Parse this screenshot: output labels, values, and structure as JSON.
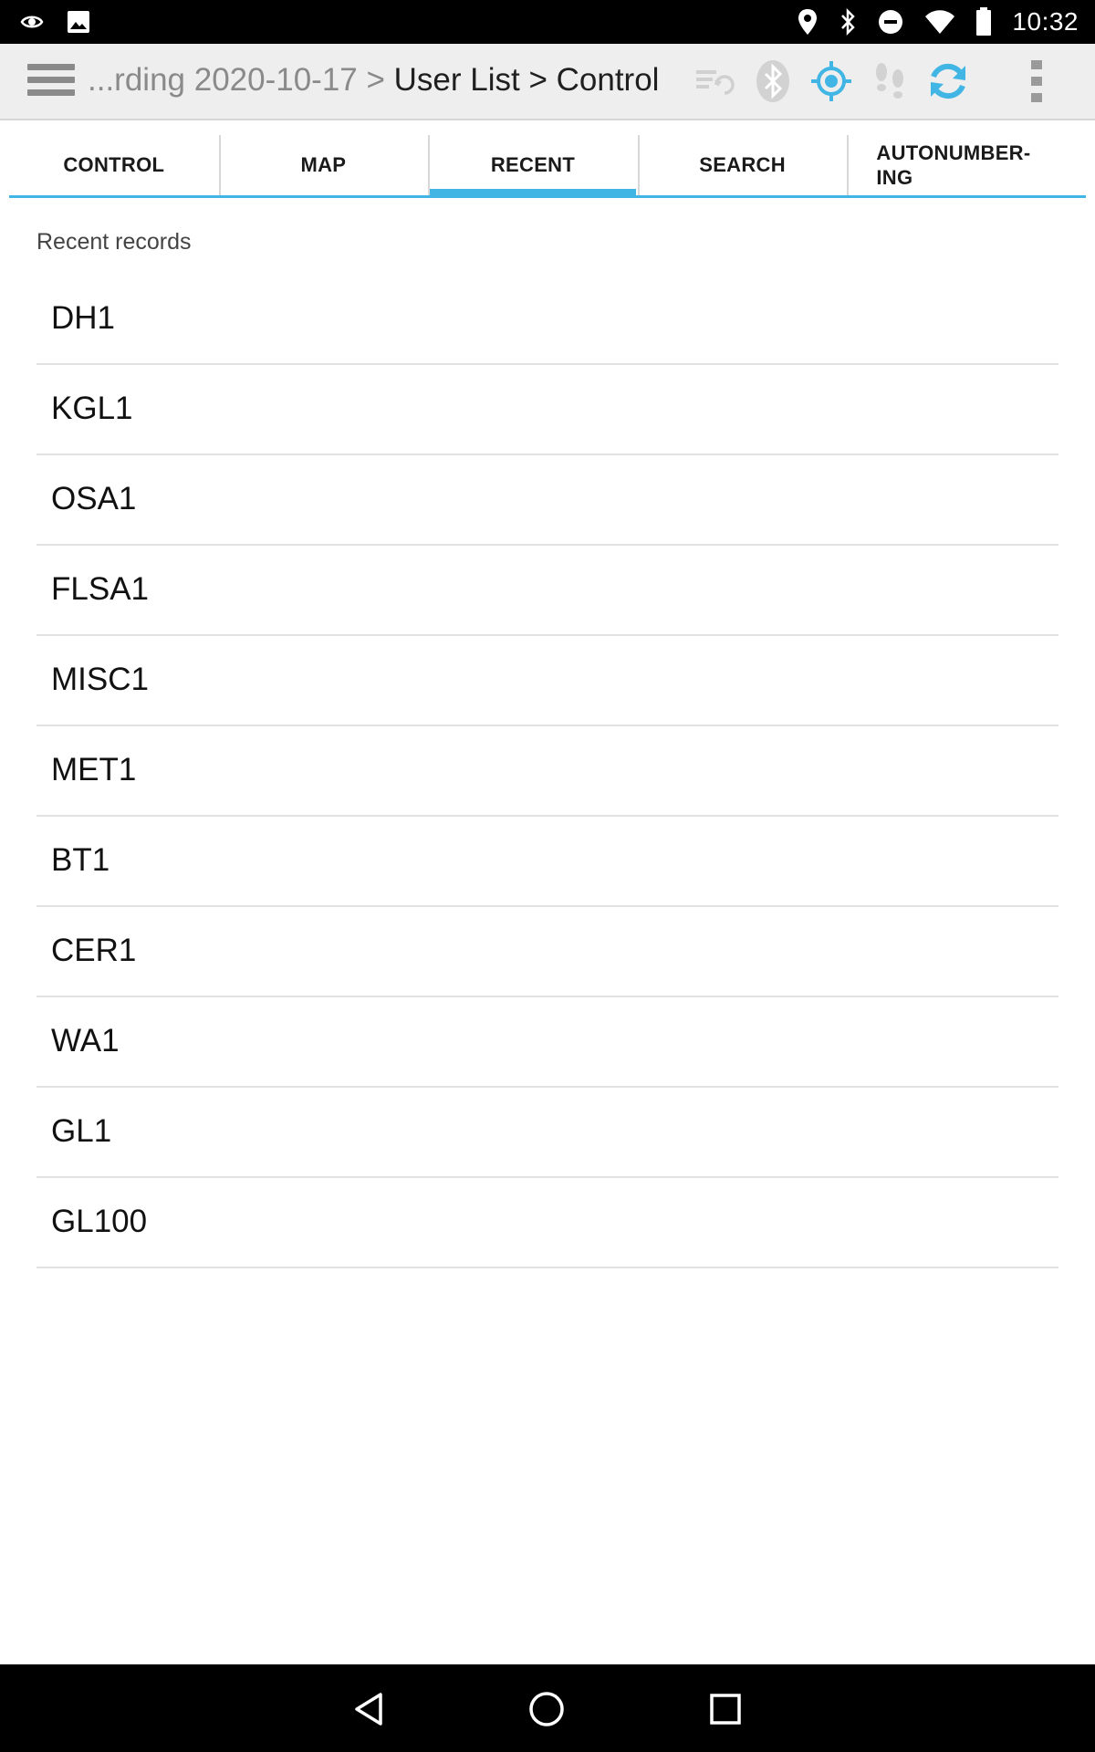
{
  "status_bar": {
    "time": "10:32",
    "icons": [
      "eye-icon",
      "image-icon",
      "location-pin-icon",
      "bluetooth-icon",
      "do-not-disturb-icon",
      "wifi-icon",
      "battery-icon"
    ]
  },
  "app_bar": {
    "breadcrumb_muted": "...rding 2020-10-17 > ",
    "breadcrumb_main": "User List > Control",
    "icons": [
      "menu-icon",
      "sync-list-icon",
      "bluetooth-icon",
      "gps-target-icon",
      "footsteps-icon",
      "refresh-icon",
      "overflow-menu-icon"
    ],
    "colors": {
      "accent": "#41b5e3",
      "muted": "#c8c8c8"
    }
  },
  "tabs": [
    {
      "label": "CONTROL",
      "active": false
    },
    {
      "label": "MAP",
      "active": false
    },
    {
      "label": "RECENT",
      "active": true
    },
    {
      "label": "SEARCH",
      "active": false
    },
    {
      "label": "AUTONUMBER-\nING",
      "active": false
    }
  ],
  "recent": {
    "title": "Recent records",
    "items": [
      "DH1",
      "KGL1",
      "OSA1",
      "FLSA1",
      "MISC1",
      "MET1",
      "BT1",
      "CER1",
      "WA1",
      "GL1",
      "GL100"
    ]
  },
  "nav_bar": {
    "icons": [
      "back-icon",
      "home-icon",
      "recents-icon"
    ]
  }
}
